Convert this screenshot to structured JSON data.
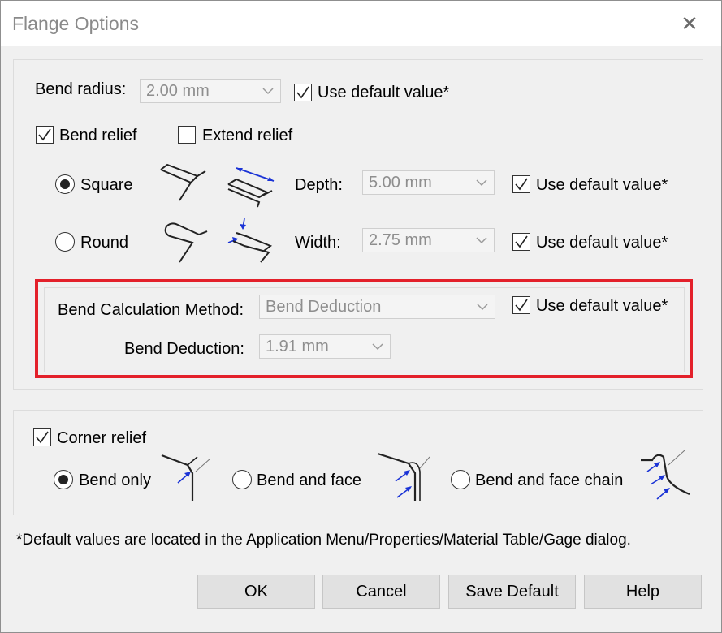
{
  "window": {
    "title": "Flange Options",
    "close_glyph": "✕"
  },
  "bend": {
    "radius_label": "Bend radius:",
    "radius_value": "2.00 mm",
    "radius_default_label": "Use default value*",
    "radius_default_checked": true,
    "relief_label": "Bend relief",
    "relief_checked": true,
    "extend_label": "Extend relief",
    "extend_checked": false,
    "square_label": "Square",
    "square_selected": true,
    "round_label": "Round",
    "round_selected": false,
    "depth_label": "Depth:",
    "depth_value": "5.00 mm",
    "depth_default_label": "Use default value*",
    "depth_default_checked": true,
    "width_label": "Width:",
    "width_value": "2.75 mm",
    "width_default_label": "Use default value*",
    "width_default_checked": true
  },
  "calc": {
    "method_label": "Bend Calculation Method:",
    "method_value": "Bend Deduction",
    "method_default_label": "Use default value*",
    "method_default_checked": true,
    "deduction_label": "Bend Deduction:",
    "deduction_value": "1.91 mm"
  },
  "corner": {
    "relief_label": "Corner relief",
    "relief_checked": true,
    "bend_only_label": "Bend only",
    "bend_only_selected": true,
    "bend_face_label": "Bend and face",
    "bend_face_chain_label": "Bend and face chain"
  },
  "note": "*Default values are located in the Application Menu/Properties/Material Table/Gage dialog.",
  "buttons": {
    "ok": "OK",
    "cancel": "Cancel",
    "save_default": "Save Default",
    "help": "Help"
  },
  "colors": {
    "highlight_border": "#e3202a",
    "icon_arrow": "#1a33d6",
    "disabled_text": "#8e8e8e"
  }
}
